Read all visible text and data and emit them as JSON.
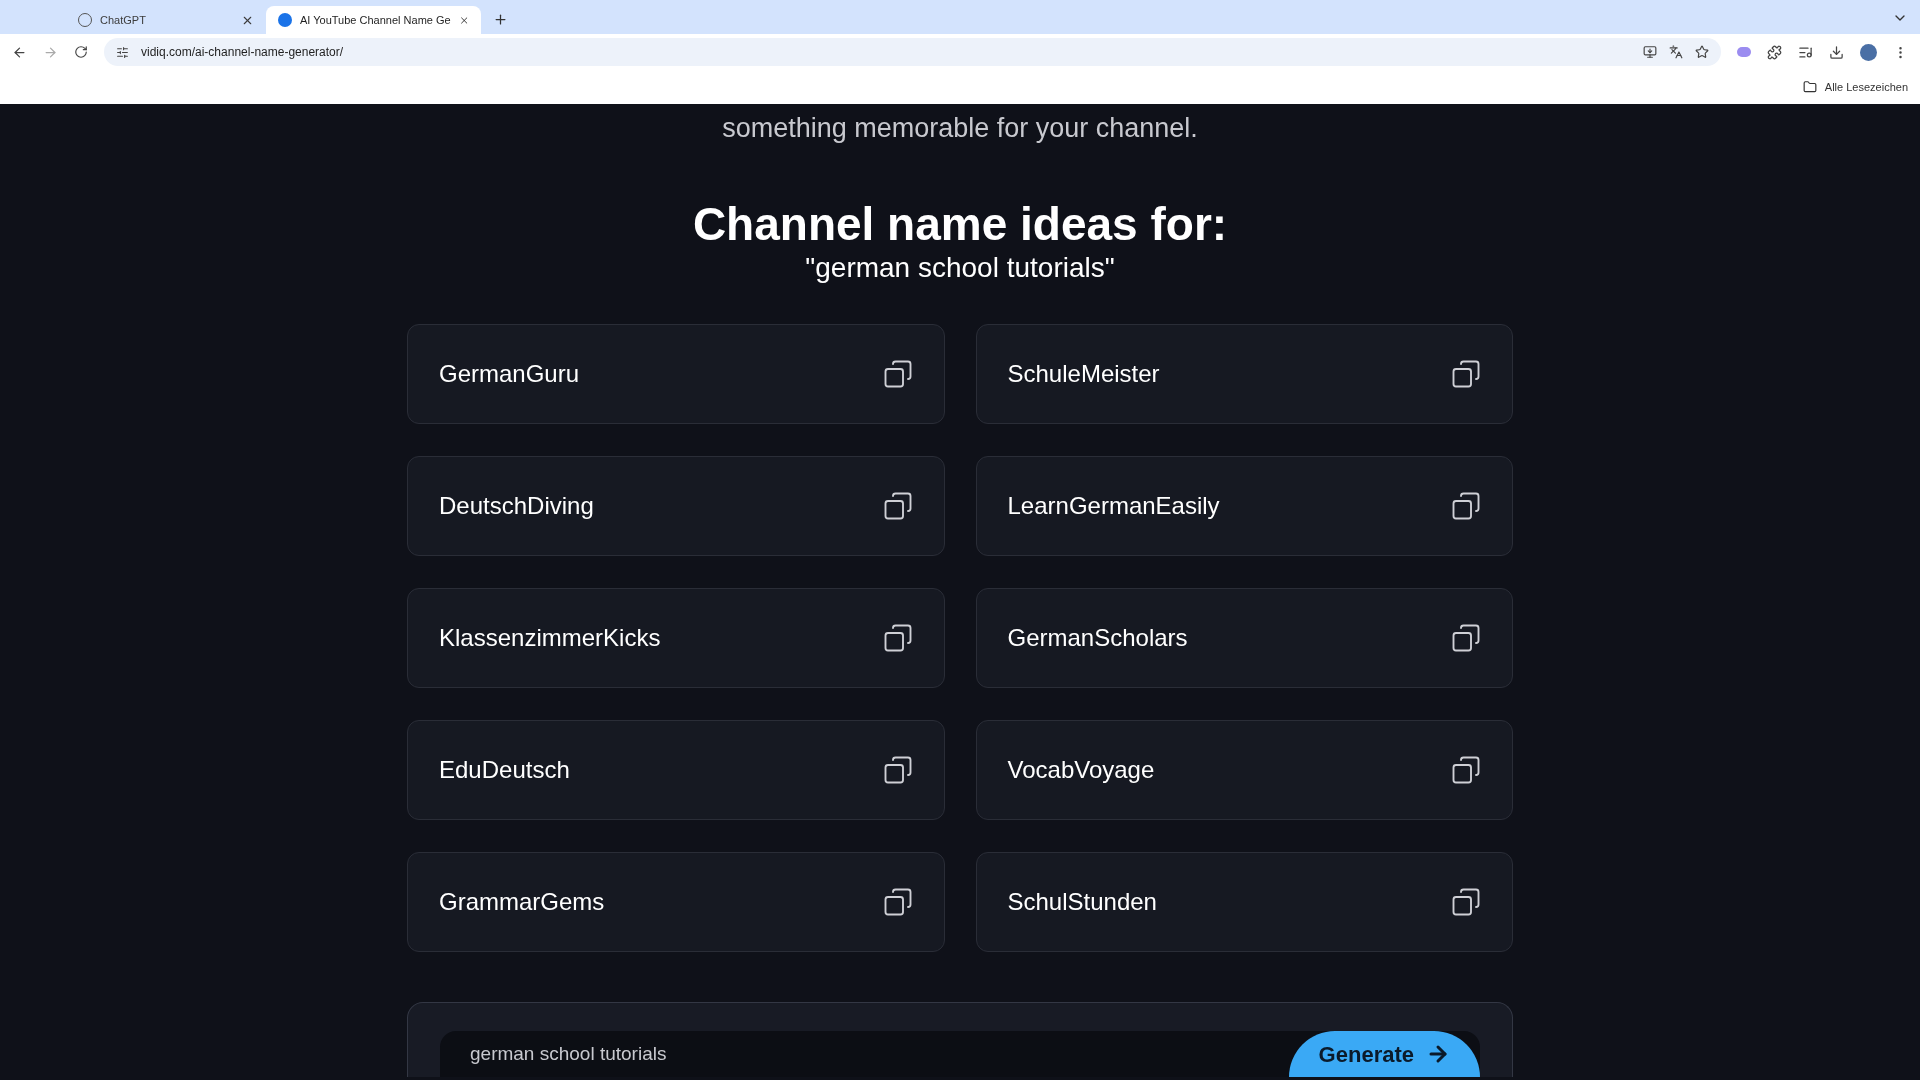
{
  "browser": {
    "tabs": [
      {
        "title": "ChatGPT",
        "selected": false
      },
      {
        "title": "AI YouTube Channel Name Ge",
        "selected": true
      }
    ],
    "url": "vidiq.com/ai-channel-name-generator/",
    "bookmarks_label": "Alle Lesezeichen"
  },
  "intro_fragment": "something memorable for your channel.",
  "heading": "Channel name ideas for:",
  "query": "\"german school tutorials\"",
  "names": [
    "GermanGuru",
    "SchuleMeister",
    "DeutschDiving",
    "LearnGermanEasily",
    "KlassenzimmerKicks",
    "GermanScholars",
    "EduDeutsch",
    "VocabVoyage",
    "GrammarGems",
    "SchulStunden"
  ],
  "generator": {
    "value": "german school tutorials",
    "button": "Generate"
  }
}
